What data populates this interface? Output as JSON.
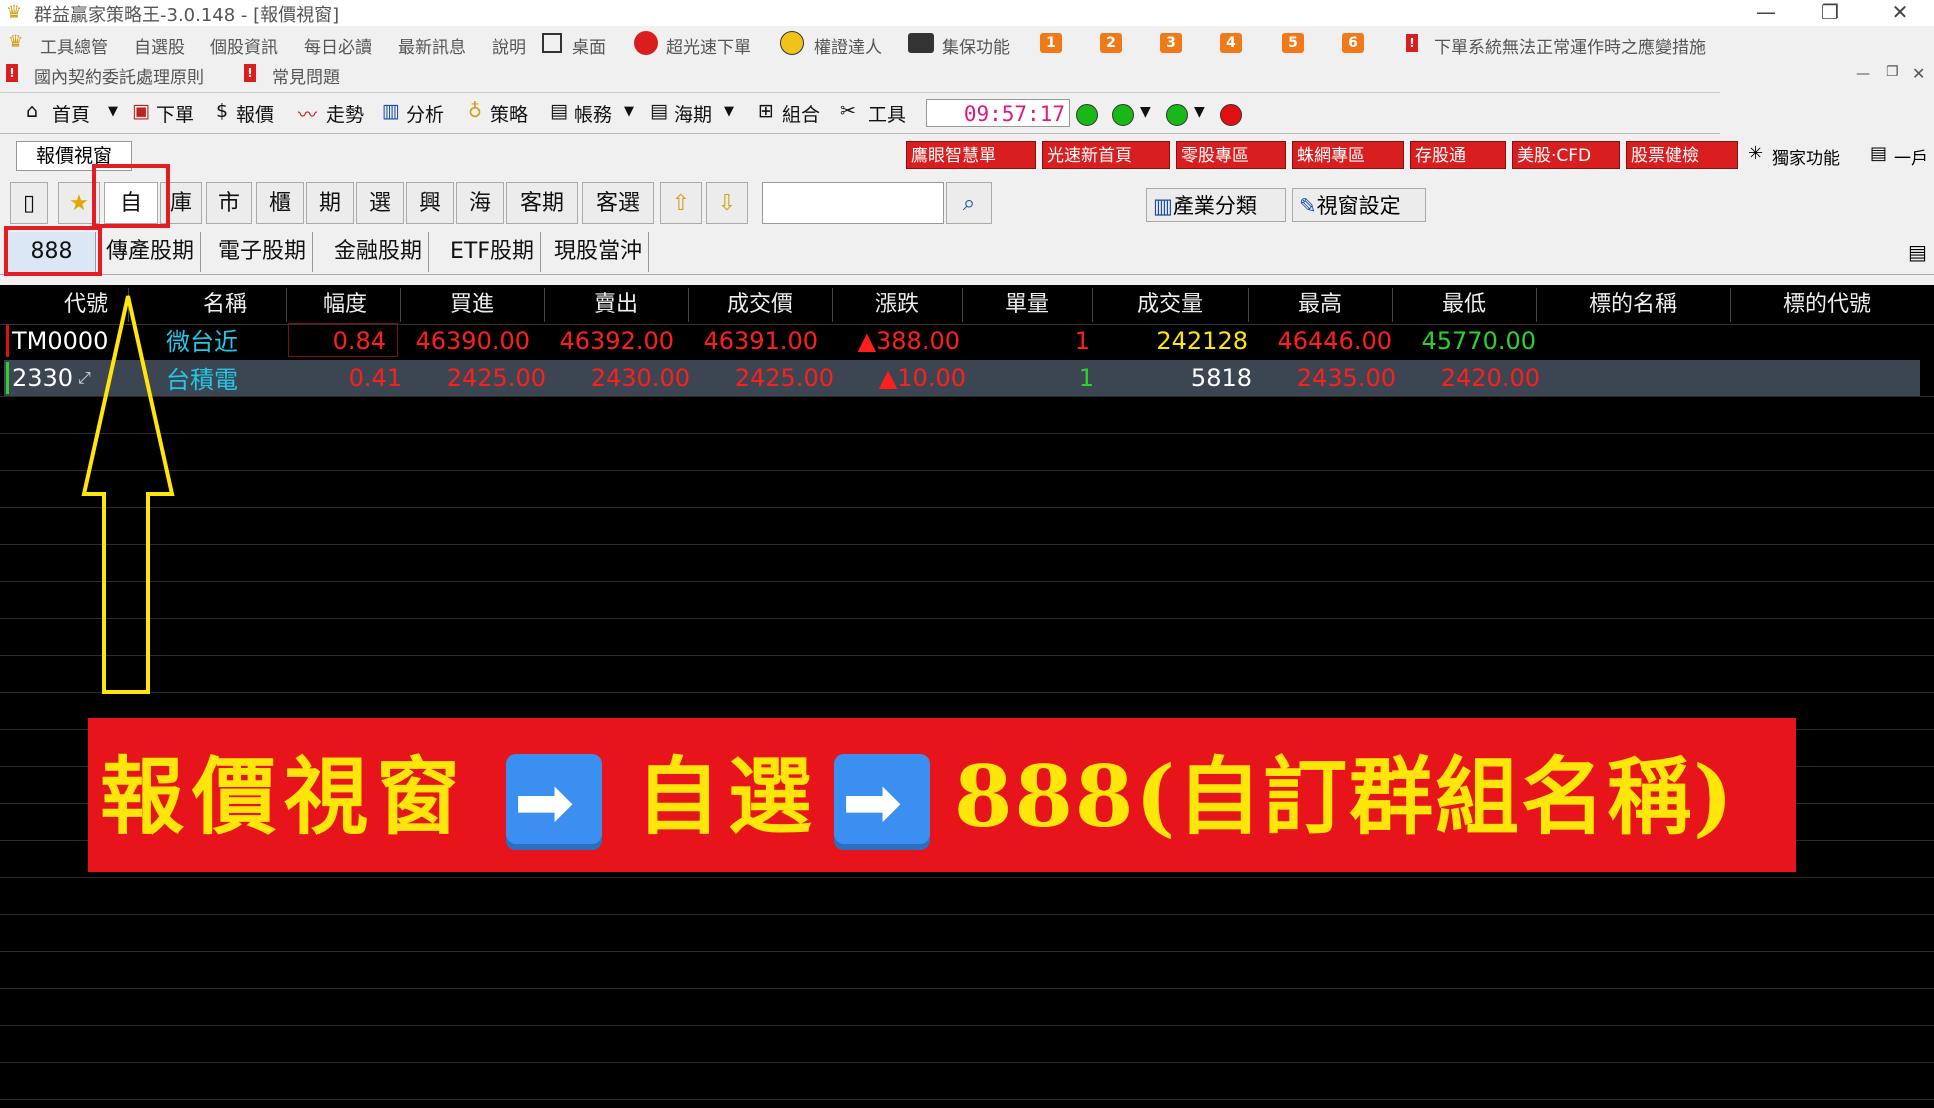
{
  "window": {
    "title": "群益贏家策略王-3.0.148 - [報價視窗]",
    "min": "—",
    "max": "❐",
    "close": "✕"
  },
  "menu": {
    "items": [
      "工具總管",
      "自選股",
      "個股資訊",
      "每日必讀",
      "最新訊息",
      "說明",
      "桌面",
      "超光速下單",
      "權證達人",
      "集保功能"
    ],
    "badges": [
      "1",
      "2",
      "3",
      "4",
      "5",
      "6"
    ],
    "notice": "下單系統無法正常運作時之應變措施",
    "row2_items": [
      "國內契約委託處理原則",
      "常見問題"
    ]
  },
  "toolbar": {
    "items": [
      "首頁",
      "下單",
      "報價",
      "走勢",
      "分析",
      "策略",
      "帳務",
      "海期",
      "組合",
      "工具"
    ],
    "clock": "09:57:17"
  },
  "row2": {
    "window_tab": "報價視窗",
    "red_buttons": [
      "鷹眼智慧單",
      "光速新首頁",
      "零股專區",
      "蛛網專區",
      "存股通",
      "美股‧CFD",
      "股票健檢"
    ],
    "exclusive": "獨家功能",
    "onehu": "一戶"
  },
  "tabs": {
    "items": [
      "自",
      "庫",
      "市",
      "櫃",
      "期",
      "選",
      "興",
      "海",
      "客期",
      "客選"
    ],
    "industry": "產業分類",
    "window_settings": "視窗設定"
  },
  "groups": [
    "888",
    "傳產股期",
    "電子股期",
    "金融股期",
    "ETF股期",
    "現股當沖"
  ],
  "table": {
    "headers": [
      "代號",
      "名稱",
      "幅度",
      "買進",
      "賣出",
      "成交價",
      "漲跌",
      "單量",
      "成交量",
      "最高",
      "最低",
      "標的名稱",
      "標的代號"
    ],
    "rows": [
      {
        "code": "TM0000",
        "name": "微台近",
        "pct": "0.84",
        "bid": "46390.00",
        "ask": "46392.00",
        "last": "46391.00",
        "chg": "▲388.00",
        "vol1": "1",
        "vol": "242128",
        "high": "46446.00",
        "low": "45770.00"
      },
      {
        "code": "2330",
        "name": "台積電",
        "pct": "0.41",
        "bid": "2425.00",
        "ask": "2430.00",
        "last": "2425.00",
        "chg": "▲10.00",
        "vol1": "1",
        "vol": "5818",
        "high": "2435.00",
        "low": "2420.00"
      }
    ]
  },
  "banner": {
    "part1": "報價視窗",
    "part2": "自選",
    "part3": "888(自訂群組名稱)",
    "arrow": "➡"
  },
  "colors": {
    "red": "#ff1e1e",
    "green": "#2ed02e",
    "cyan": "#21c8e8",
    "yellow": "#ffe60a",
    "banner": "#e8141c"
  }
}
